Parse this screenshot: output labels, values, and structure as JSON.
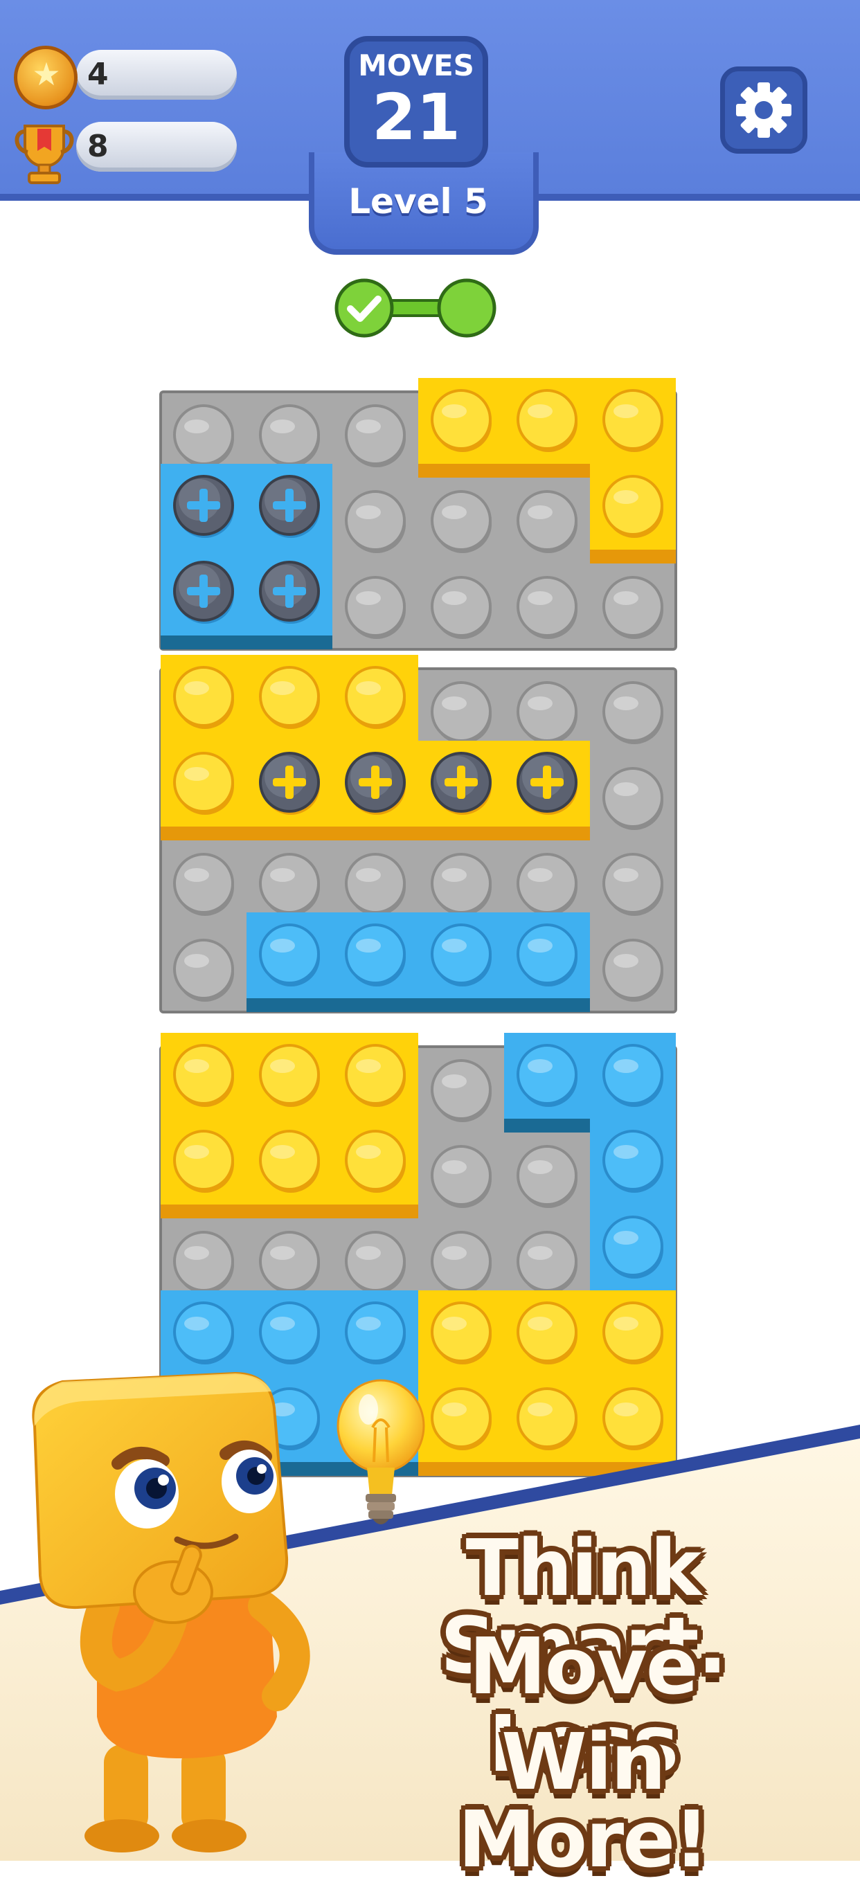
{
  "hud": {
    "coins": "4",
    "trophies": "8",
    "moves_label": "MOVES",
    "moves_value": "21",
    "level": "Level 5",
    "settings_icon": "gear-icon"
  },
  "progress": {
    "stages_total": 2,
    "stages_completed": 1
  },
  "boards": [
    {
      "cols": 6,
      "rows": 3,
      "blocks": [
        {
          "color": "blue",
          "cells": [
            [
              0,
              1
            ],
            [
              1,
              1
            ],
            [
              0,
              2
            ],
            [
              1,
              2
            ]
          ],
          "locked": true
        },
        {
          "color": "yellow",
          "cells": [
            [
              3,
              0
            ],
            [
              4,
              0
            ],
            [
              5,
              0
            ],
            [
              5,
              1
            ]
          ],
          "locked": false
        }
      ]
    },
    {
      "cols": 6,
      "rows": 4,
      "blocks": [
        {
          "color": "yellow",
          "cells": [
            [
              0,
              0
            ],
            [
              1,
              0
            ],
            [
              2,
              0
            ],
            [
              0,
              1
            ]
          ],
          "locked": false
        },
        {
          "color": "yellow",
          "cells": [
            [
              1,
              1
            ],
            [
              2,
              1
            ],
            [
              3,
              1
            ],
            [
              4,
              1
            ]
          ],
          "locked": true
        },
        {
          "color": "blue",
          "cells": [
            [
              1,
              3
            ],
            [
              2,
              3
            ],
            [
              3,
              3
            ],
            [
              4,
              3
            ]
          ],
          "locked": false
        }
      ]
    },
    {
      "cols": 6,
      "rows": 5,
      "blocks": [
        {
          "color": "yellow",
          "cells": [
            [
              0,
              0
            ],
            [
              1,
              0
            ],
            [
              2,
              0
            ],
            [
              0,
              1
            ],
            [
              1,
              1
            ],
            [
              2,
              1
            ]
          ],
          "locked": false
        },
        {
          "color": "blue",
          "cells": [
            [
              4,
              0
            ],
            [
              5,
              0
            ],
            [
              5,
              1
            ],
            [
              5,
              2
            ]
          ],
          "locked": false
        },
        {
          "color": "blue",
          "cells": [
            [
              0,
              3
            ],
            [
              1,
              3
            ],
            [
              2,
              3
            ],
            [
              0,
              4
            ],
            [
              1,
              4
            ],
            [
              2,
              4
            ]
          ],
          "locked": false
        },
        {
          "color": "yellow",
          "cells": [
            [
              3,
              3
            ],
            [
              4,
              3
            ],
            [
              5,
              3
            ],
            [
              3,
              4
            ],
            [
              4,
              4
            ],
            [
              5,
              4
            ]
          ],
          "locked": false
        }
      ]
    }
  ],
  "colors": {
    "yellow": "#ffd20a",
    "blue": "#3fb0f0",
    "gray": "#a9a9a9",
    "header": "#5b7fdc"
  },
  "promo": {
    "line1": "Think Smart.",
    "line2": "Move Less",
    "line3": "Win More!",
    "mascot": "yellow-cube-mascot",
    "hint_icon": "lightbulb-icon"
  }
}
